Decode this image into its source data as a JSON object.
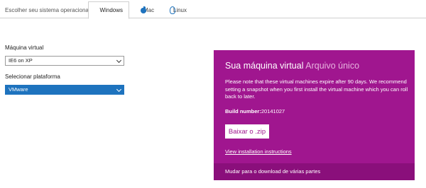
{
  "os_selector": {
    "label": "Escolher seu sistema operacional:",
    "tabs": [
      {
        "label": "Windows",
        "icon": "windows-icon",
        "active": true
      },
      {
        "label": "Mac",
        "icon": "apple-icon",
        "active": false
      },
      {
        "label": "Linux",
        "icon": "linux-icon",
        "active": false
      }
    ]
  },
  "form": {
    "vm_label": "Máquina virtual",
    "vm_value": "IE6 on XP",
    "platform_label": "Selecionar plataforma",
    "platform_value": "VMware"
  },
  "card": {
    "title": "Sua máquina virtual",
    "subtitle": "Arquivo único",
    "description": "Please note that these virtual machines expire after 90 days. We recommend setting a snapshot when you first install the virtual machine which you can roll back to later.",
    "build_label": "Build number:",
    "build_value": "20141027",
    "download_button": "Baixar o .zip",
    "instructions_link": "View installation instructions",
    "switch_link": "Mudar para o download de várias partes"
  },
  "colors": {
    "card_bg": "#a0168f",
    "card_footer_bg": "#8a0f7b",
    "accent_blue": "#1e73be"
  }
}
